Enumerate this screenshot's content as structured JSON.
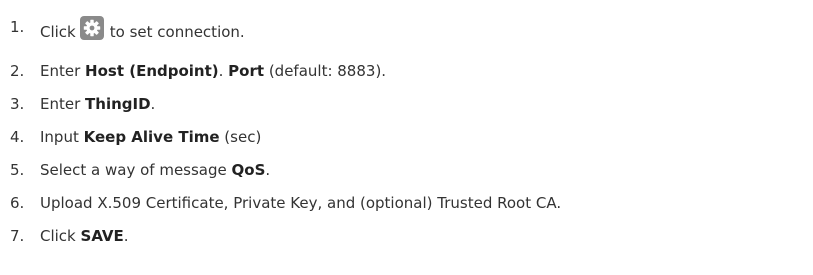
{
  "steps": [
    {
      "number": "1.",
      "before": "Click",
      "icon": "gear-icon",
      "after": "to set connection."
    },
    {
      "number": "2.",
      "before": "Enter ",
      "bold1": "Host (Endpoint)",
      "middle": ". ",
      "bold2": "Port",
      "after": " (default: 8883)."
    },
    {
      "number": "3.",
      "before": "Enter ",
      "bold1": "ThingID",
      "after": "."
    },
    {
      "number": "4.",
      "before": "Input ",
      "bold1": "Keep Alive Time",
      "after": " (sec)"
    },
    {
      "number": "5.",
      "before": "Select a way of message ",
      "bold1": "QoS",
      "after": "."
    },
    {
      "number": "6.",
      "text": "Upload X.509 Certificate, Private Key, and (optional) Trusted Root CA."
    },
    {
      "number": "7.",
      "before": "Click ",
      "bold1": "SAVE",
      "after": "."
    }
  ]
}
